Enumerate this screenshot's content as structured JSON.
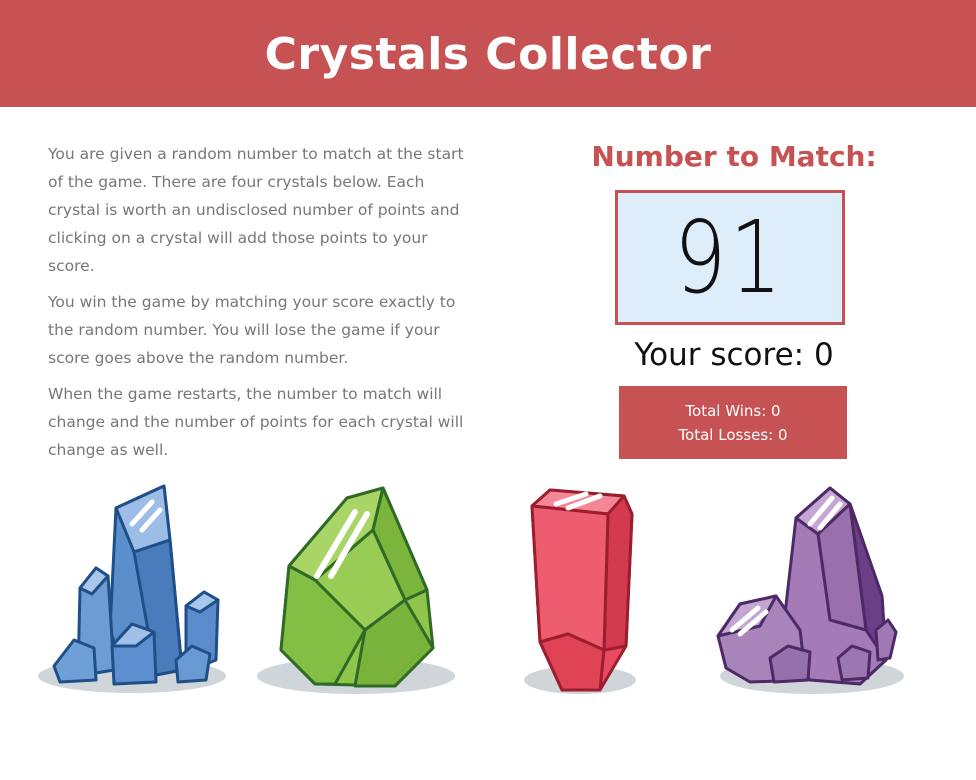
{
  "header": {
    "title": "Crystals Collector"
  },
  "instructions": [
    "You are given a random number to match at the start of the game. There are four crystals below. Each crystal is worth an undisclosed number of points and clicking on a crystal will add those points to your score.",
    "You win the game by matching your score exactly to the random number. You will lose the game if your score goes above the random number.",
    "When the game restarts, the number to match will change and the number of points for each crystal will change as well."
  ],
  "match": {
    "title": "Number to Match:",
    "target": "91"
  },
  "score": {
    "label": "Your score: 0",
    "value": 0
  },
  "tally": {
    "wins": "Total Wins: 0",
    "losses": "Total Losses: 0"
  },
  "crystals": [
    {
      "name": "blue-crystal",
      "icon": "blue-crystal-icon",
      "color": "#5b8fcc"
    },
    {
      "name": "green-crystal",
      "icon": "green-crystal-icon",
      "color": "#8ec54a"
    },
    {
      "name": "red-crystal",
      "icon": "red-crystal-icon",
      "color": "#e84a5f"
    },
    {
      "name": "purple-crystal",
      "icon": "purple-crystal-icon",
      "color": "#a47bb7"
    }
  ],
  "colors": {
    "accent": "#c75254",
    "target_bg": "#ddedf9",
    "text": "#777777",
    "shadow": "#cfd5d8"
  }
}
